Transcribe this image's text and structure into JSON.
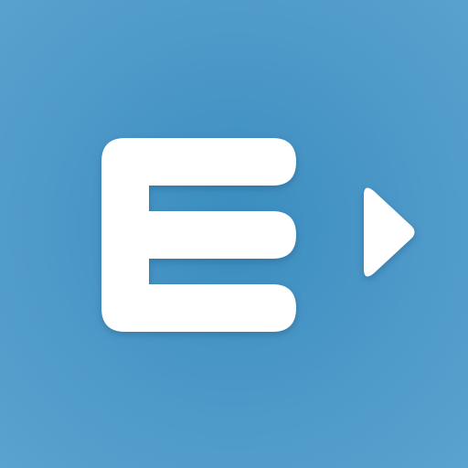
{
  "icon": {
    "letter": "E",
    "symbol": "play-arrow-icon",
    "background_color": "#4a97c7",
    "foreground_color": "#ffffff"
  }
}
